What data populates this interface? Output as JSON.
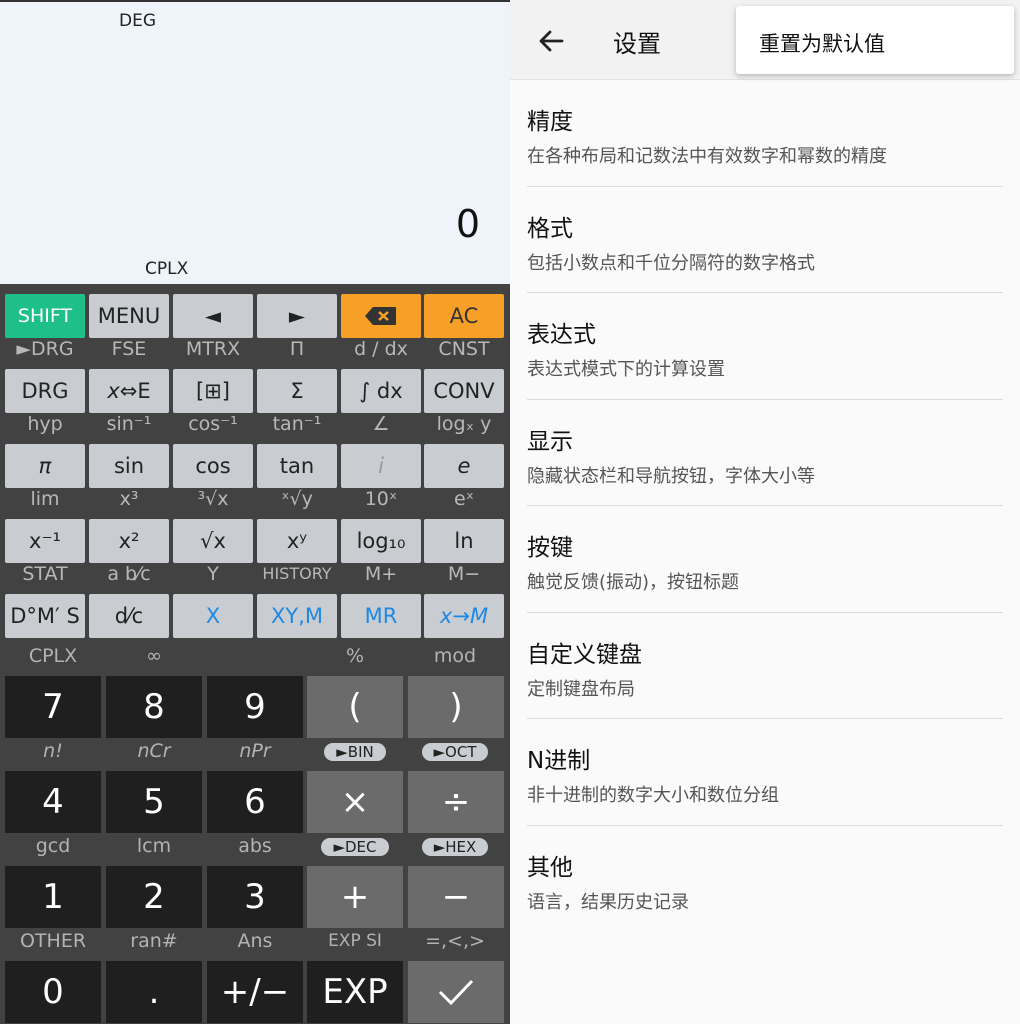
{
  "calculator": {
    "display": {
      "angle_mode": "DEG",
      "result": "0",
      "complex_mode": "CPLX"
    },
    "sci_rows": [
      {
        "labels": [
          "",
          "",
          "",
          "",
          "",
          ""
        ],
        "buttons": [
          "SHIFT",
          "MENU",
          "◄",
          "►",
          "⌫",
          "AC"
        ]
      },
      {
        "labels": [
          "►DRG",
          "FSE",
          "MTRX",
          "Π",
          "d / dx",
          "CNST"
        ],
        "buttons": [
          "DRG",
          "x⇔E",
          "[⊞]",
          "Σ",
          "∫ dx",
          "CONV"
        ]
      },
      {
        "labels": [
          "hyp",
          "sin⁻¹",
          "cos⁻¹",
          "tan⁻¹",
          "∠",
          "logₓ y"
        ],
        "buttons": [
          "π",
          "sin",
          "cos",
          "tan",
          "i",
          "e"
        ]
      },
      {
        "labels": [
          "lim",
          "x³",
          "³√x",
          "ˣ√y",
          "10ˣ",
          "eˣ"
        ],
        "buttons": [
          "x⁻¹",
          "x²",
          "√x",
          "xʸ",
          "log₁₀",
          "ln"
        ]
      },
      {
        "labels": [
          "STAT",
          "a b⁄c",
          "Y",
          "HISTORY",
          "M+",
          "M−"
        ],
        "buttons": [
          "D°M′ S",
          "d⁄c",
          "X",
          "XY,M",
          "MR",
          "x→M"
        ]
      }
    ],
    "num_rows": [
      {
        "labels": [
          "CPLX",
          "∞",
          "",
          "%",
          "mod"
        ],
        "buttons": [
          "7",
          "8",
          "9",
          "(",
          ")"
        ]
      },
      {
        "labels": [
          "n!",
          "nCr",
          "nPr",
          "►BIN",
          "►OCT"
        ],
        "buttons": [
          "4",
          "5",
          "6",
          "×",
          "÷"
        ]
      },
      {
        "labels": [
          "gcd",
          "lcm",
          "abs",
          "►DEC",
          "►HEX"
        ],
        "buttons": [
          "1",
          "2",
          "3",
          "+",
          "−"
        ]
      },
      {
        "labels": [
          "OTHER",
          "ran#",
          "Ans",
          "EXP SI",
          "=,<,>"
        ],
        "buttons": [
          "0",
          ".",
          "+/−",
          "EXP",
          "✓"
        ]
      }
    ]
  },
  "settings": {
    "title": "设置",
    "reset_menu_item": "重置为默认值",
    "items": [
      {
        "title": "精度",
        "subtitle": "在各种布局和记数法中有效数字和幂数的精度"
      },
      {
        "title": "格式",
        "subtitle": "包括小数点和千位分隔符的数字格式"
      },
      {
        "title": "表达式",
        "subtitle": "表达式模式下的计算设置"
      },
      {
        "title": "显示",
        "subtitle": "隐藏状态栏和导航按钮，字体大小等"
      },
      {
        "title": "按键",
        "subtitle": "触觉反馈(振动)，按钮标题"
      },
      {
        "title": "自定义键盘",
        "subtitle": "定制键盘布局"
      },
      {
        "title": "N进制",
        "subtitle": "非十进制的数字大小和数位分组"
      },
      {
        "title": "其他",
        "subtitle": "语言，结果历史记录"
      }
    ]
  }
}
